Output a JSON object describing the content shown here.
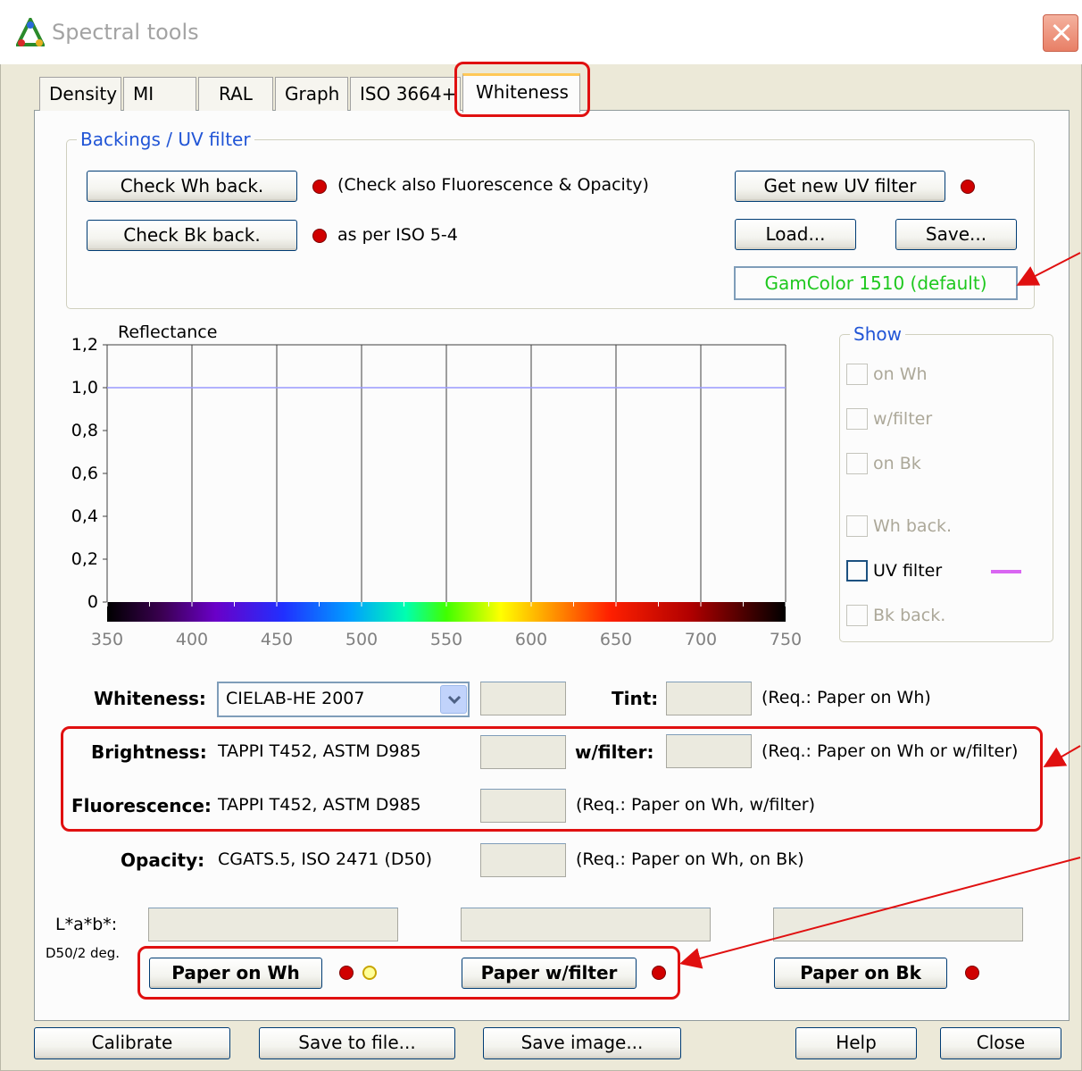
{
  "window": {
    "title": "Spectral tools"
  },
  "tabs": [
    "Density",
    "MI",
    "RAL",
    "Graph",
    "ISO 3664+",
    "Whiteness"
  ],
  "active_tab": "Whiteness",
  "backings": {
    "caption": "Backings / UV filter",
    "check_wh_label": "Check Wh back.",
    "check_wh_note": "(Check also Fluorescence & Opacity)",
    "check_bk_label": "Check Bk back.",
    "check_bk_note": "as per ISO 5-4",
    "get_uv_label": "Get new UV filter",
    "load_label": "Load...",
    "save_label": "Save...",
    "uv_filter_name": "GamColor 1510 (default)"
  },
  "chart_data": {
    "type": "line",
    "ylabel": "Reflectance",
    "x_ticks": [
      "350",
      "400",
      "450",
      "500",
      "550",
      "600",
      "650",
      "700",
      "750"
    ],
    "y_ticks": [
      "1,2",
      "1,0",
      "0,8",
      "0,6",
      "0,4",
      "0,2",
      "0"
    ],
    "xlim": [
      350,
      750
    ],
    "ylim": [
      0,
      1.2
    ],
    "reference_line_y": 1.0,
    "gridlines_x": [
      400,
      450,
      500,
      550,
      600,
      650,
      700
    ],
    "colors": {
      "reference": "#9a9aff",
      "grid": "#404040"
    }
  },
  "show": {
    "caption": "Show",
    "items": [
      {
        "label": "on Wh",
        "enabled": false
      },
      {
        "label": "w/filter",
        "enabled": false
      },
      {
        "label": "on Bk",
        "enabled": false
      },
      {
        "label": "Wh back.",
        "enabled": false
      },
      {
        "label": "UV filter",
        "enabled": true
      },
      {
        "label": "Bk back.",
        "enabled": false
      }
    ],
    "uv_filter_color": "#d966f2"
  },
  "measurements": {
    "whiteness_label": "Whiteness:",
    "whiteness_method": "CIELAB-HE 2007",
    "tint_label": "Tint:",
    "tint_req": "(Req.: Paper on Wh)",
    "brightness_label": "Brightness:",
    "brightness_std": "TAPPI T452, ASTM D985",
    "wfilter_label": "w/filter:",
    "brightness_req": "(Req.: Paper on Wh or w/filter)",
    "fluorescence_label": "Fluorescence:",
    "fluorescence_std": "TAPPI T452, ASTM D985",
    "fluorescence_req": "(Req.: Paper on Wh, w/filter)",
    "opacity_label": "Opacity:",
    "opacity_std": "CGATS.5, ISO 2471 (D50)",
    "opacity_req": "(Req.: Paper on Wh, on Bk)",
    "lab_label": "L*a*b*:",
    "lab_sub": "D50/2 deg."
  },
  "paper_buttons": {
    "on_wh": "Paper on Wh",
    "w_filter": "Paper w/filter",
    "on_bk": "Paper on Bk"
  },
  "footer": {
    "calibrate": "Calibrate",
    "save_file": "Save to file...",
    "save_image": "Save image...",
    "help": "Help",
    "close": "Close"
  },
  "colors": {
    "accent_blue": "#2155d6",
    "uv_name_green": "#1ec81e",
    "led_red": "#d00000",
    "annotation_red": "#e01010"
  }
}
